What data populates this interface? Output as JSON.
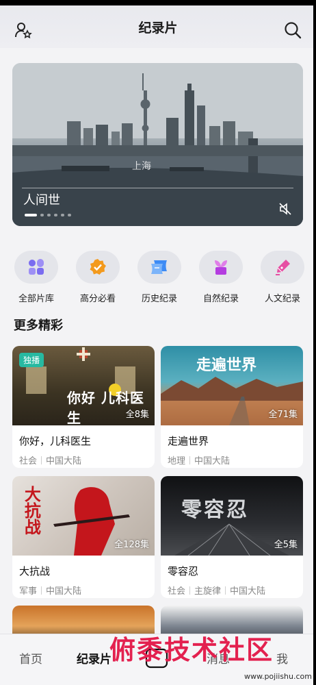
{
  "header": {
    "title": "纪录片",
    "left_icon": "user-star-icon",
    "right_icon": "search-icon"
  },
  "banner": {
    "title": "人间世",
    "overlay_text": "上海",
    "mute_icon": "mute-icon",
    "slide_count": 6,
    "active_slide": 1
  },
  "categories": [
    {
      "label": "全部片库",
      "icon": "grid-apps-icon",
      "color": "#7a6cf0"
    },
    {
      "label": "高分必看",
      "icon": "badge-check-icon",
      "color": "#f39a1d"
    },
    {
      "label": "历史纪录",
      "icon": "scroll-icon",
      "color": "#3d8bf5"
    },
    {
      "label": "自然纪录",
      "icon": "plant-icon",
      "color": "#b43de0"
    },
    {
      "label": "人文纪录",
      "icon": "pen-icon",
      "color": "#e64fa3"
    }
  ],
  "section": {
    "title": "更多精彩"
  },
  "cards": [
    {
      "title": "你好，儿科医生",
      "episodes": "全8集",
      "badge": "独播",
      "tags": [
        "社会",
        "中国大陆"
      ],
      "thumb_text": "你好 儿科医生"
    },
    {
      "title": "走遍世界",
      "episodes": "全71集",
      "badge": "",
      "tags": [
        "地理",
        "中国大陆"
      ],
      "thumb_text": "走遍世界"
    },
    {
      "title": "大抗战",
      "episodes": "全128集",
      "badge": "",
      "tags": [
        "军事",
        "中国大陆"
      ],
      "thumb_text": "大抗战"
    },
    {
      "title": "零容忍",
      "episodes": "全5集",
      "badge": "",
      "tags": [
        "社会",
        "主旋律",
        "中国大陆"
      ],
      "thumb_text": "零容忍"
    }
  ],
  "bottom_nav": [
    {
      "label": "首页",
      "active": false
    },
    {
      "label": "纪录片",
      "active": true
    },
    {
      "label": "消息",
      "active": false
    },
    {
      "label": "我",
      "active": false
    }
  ],
  "watermark": {
    "text": "俯黍技术社区",
    "url": "www.pojiishu.com"
  }
}
